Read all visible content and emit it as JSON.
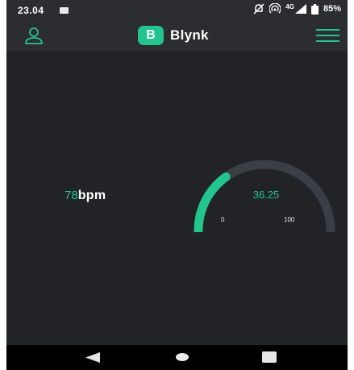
{
  "status_bar": {
    "time": "23.04",
    "network": "4G",
    "battery": "85%",
    "icons": [
      "image-icon",
      "muted-icon",
      "hotspot-icon",
      "signal-icon",
      "battery-icon"
    ]
  },
  "app_bar": {
    "logo_letter": "B",
    "title": "Blynk",
    "icons": [
      "profile-icon",
      "menu-icon"
    ]
  },
  "widgets": {
    "value_display": {
      "value": "78",
      "unit": "bpm"
    },
    "gauge": {
      "value": "36.25",
      "min": "0",
      "max": "100",
      "fraction": 0.3625
    }
  },
  "nav_bar": {
    "icons": [
      "back-icon",
      "home-icon",
      "recents-icon"
    ]
  },
  "colors": {
    "accent": "#23c48e",
    "background": "#212327",
    "appbar": "#2b2d31",
    "track": "#3b3f45"
  }
}
